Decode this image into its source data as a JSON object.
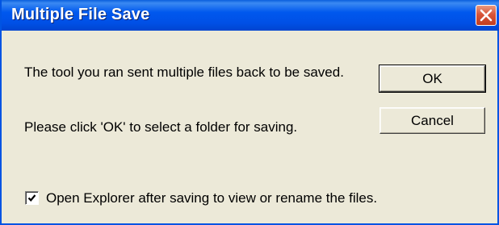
{
  "window": {
    "title": "Multiple File Save",
    "close_icon": "close-icon"
  },
  "message": {
    "line1": "The tool you ran sent multiple files back to be saved.",
    "line2": "Please click 'OK' to select a folder for saving."
  },
  "buttons": {
    "ok_label": "OK",
    "cancel_label": "Cancel"
  },
  "checkbox": {
    "label": "Open Explorer after saving to view or rename the files.",
    "checked": true
  },
  "colors": {
    "titlebar": "#0058ee",
    "close_button": "#d8553a",
    "dialog_background": "#ece9d8"
  }
}
